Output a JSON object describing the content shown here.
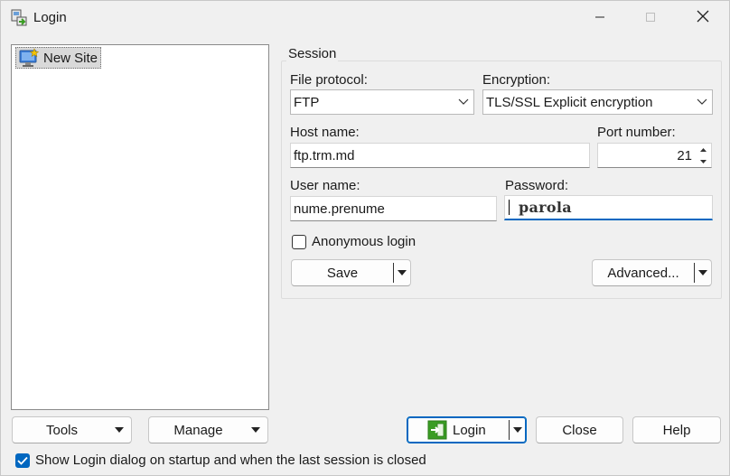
{
  "window": {
    "title": "Login",
    "icons": {
      "app": "winscp-login-icon",
      "minimize": "minimize-icon",
      "maximize": "maximize-icon",
      "close": "close-icon"
    }
  },
  "site_tree": {
    "items": [
      {
        "label": "New Site",
        "icon": "monitor-star-icon",
        "selected": true
      }
    ]
  },
  "session": {
    "legend": "Session",
    "file_protocol": {
      "label": "File protocol:",
      "value": "FTP"
    },
    "encryption": {
      "label": "Encryption:",
      "value": "TLS/SSL Explicit encryption"
    },
    "host": {
      "label": "Host name:",
      "value": "ftp.trm.md"
    },
    "port": {
      "label": "Port number:",
      "value": "21"
    },
    "user": {
      "label": "User name:",
      "value": "nume.prenume"
    },
    "password": {
      "label": "Password:",
      "value": "parola"
    },
    "anonymous": {
      "label": "Anonymous login",
      "checked": false
    },
    "save_label": "Save",
    "advanced_label": "Advanced..."
  },
  "bottom": {
    "tools_label": "Tools",
    "manage_label": "Manage",
    "login_label": "Login",
    "close_label": "Close",
    "help_label": "Help",
    "show_login_label": "Show Login dialog on startup and when the last session is closed",
    "show_login_checked": true
  },
  "colors": {
    "accent": "#0067c0",
    "window_bg": "#f0f0f0",
    "login_icon_green": "#3a9d23"
  }
}
